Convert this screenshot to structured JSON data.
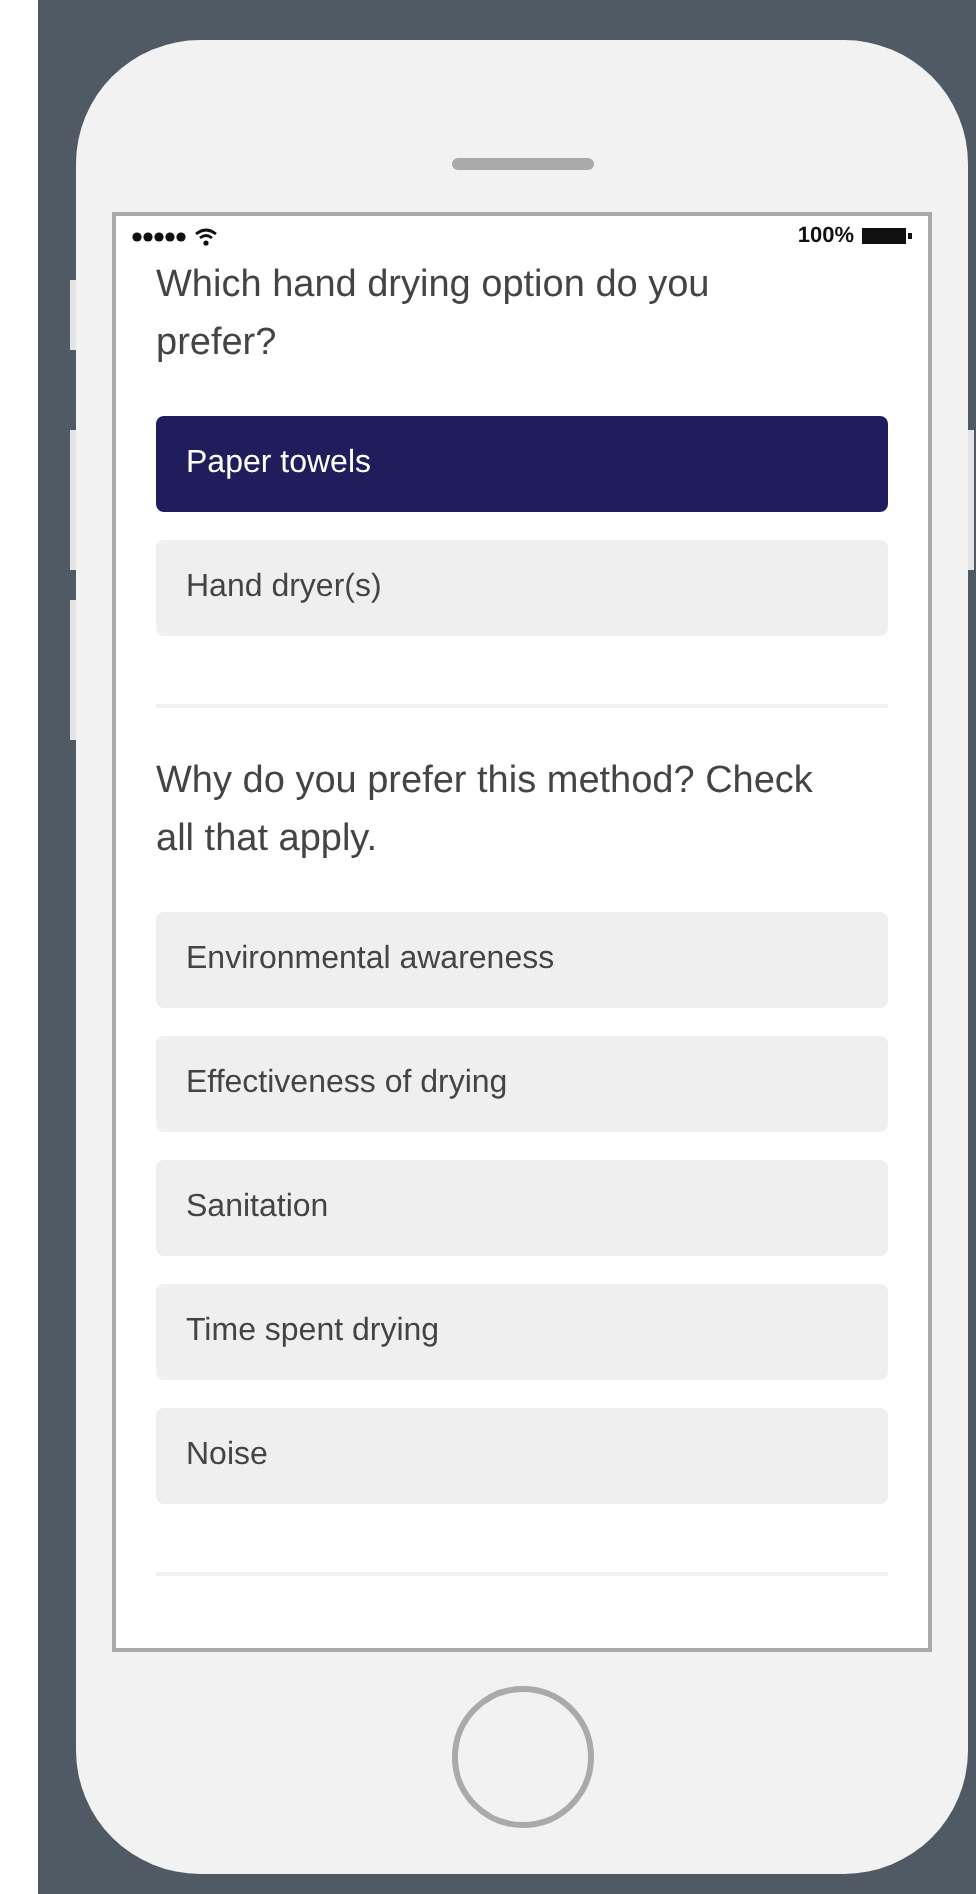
{
  "status_bar": {
    "battery": "100%"
  },
  "questions": [
    {
      "text": "Which hand drying option do you prefer?",
      "options": [
        {
          "label": "Paper towels",
          "selected": true
        },
        {
          "label": "Hand dryer(s)",
          "selected": false
        }
      ]
    },
    {
      "text": "Why do you prefer this method? Check all that apply.",
      "options": [
        {
          "label": "Environmental awareness",
          "selected": false
        },
        {
          "label": "Effectiveness of drying",
          "selected": false
        },
        {
          "label": "Sanitation",
          "selected": false
        },
        {
          "label": "Time spent drying",
          "selected": false
        },
        {
          "label": "Noise",
          "selected": false
        }
      ]
    }
  ]
}
